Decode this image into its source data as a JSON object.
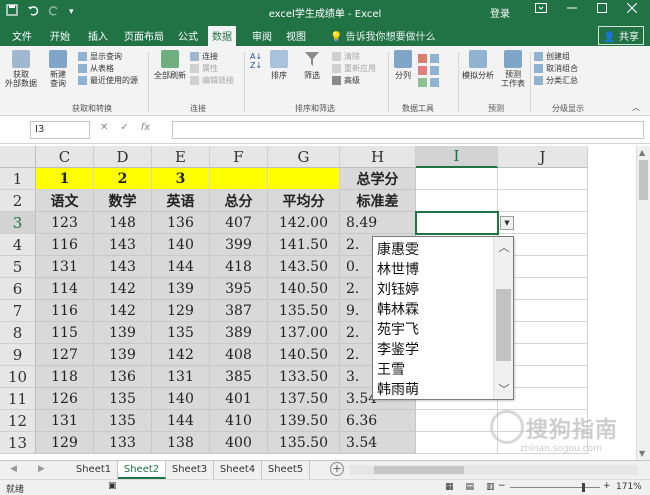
{
  "titlebar": {
    "title": "excel学生成绩单  -  Excel",
    "login": "登录",
    "accent": "#217346"
  },
  "tabs": [
    "文件",
    "开始",
    "插入",
    "页面布局",
    "公式",
    "数据",
    "审阅",
    "视图"
  ],
  "active_tab": "数据",
  "tellme": "告诉我你想要做什么",
  "share": "共享",
  "ribbon": {
    "get_external": "获取\n外部数据",
    "new_query": "新建\n查询",
    "show_queries": "显示查询",
    "from_table": "从表格",
    "recent_sources": "最近使用的源",
    "group_get_transform": "获取和转换",
    "refresh_all": "全部刷新",
    "connections": "连接",
    "properties": "属性",
    "edit_links": "编辑链接",
    "group_connections": "连接",
    "sort": "排序",
    "filter": "筛选",
    "clear": "清除",
    "reapply": "重新应用",
    "advanced": "高级",
    "group_sort_filter": "排序和筛选",
    "text_to_columns": "分列",
    "group_data_tools": "数据工具",
    "what_if": "模拟分析",
    "forecast_sheet": "预测\n工作表",
    "group_forecast": "预测",
    "group": "创建组",
    "ungroup": "取消组合",
    "subtotal": "分类汇总",
    "group_outline": "分级显示"
  },
  "namebox": "I3",
  "columns": [
    "C",
    "D",
    "E",
    "F",
    "G",
    "H",
    "I",
    "J"
  ],
  "rows": [
    {
      "num": "1",
      "cells": [
        "1",
        "2",
        "3",
        "",
        "",
        "总学分"
      ]
    },
    {
      "num": "2",
      "cells": [
        "语文",
        "数学",
        "英语",
        "总分",
        "平均分",
        "标准差"
      ]
    },
    {
      "num": "3",
      "cells": [
        "123",
        "148",
        "136",
        "407",
        "142.00",
        "8.49"
      ]
    },
    {
      "num": "4",
      "cells": [
        "116",
        "143",
        "140",
        "399",
        "141.50",
        "2."
      ]
    },
    {
      "num": "5",
      "cells": [
        "131",
        "143",
        "144",
        "418",
        "143.50",
        "0."
      ]
    },
    {
      "num": "6",
      "cells": [
        "114",
        "142",
        "139",
        "395",
        "140.50",
        "2."
      ]
    },
    {
      "num": "7",
      "cells": [
        "116",
        "142",
        "129",
        "387",
        "135.50",
        "9."
      ]
    },
    {
      "num": "8",
      "cells": [
        "115",
        "139",
        "135",
        "389",
        "137.00",
        "2."
      ]
    },
    {
      "num": "9",
      "cells": [
        "127",
        "139",
        "142",
        "408",
        "140.50",
        "2."
      ]
    },
    {
      "num": "10",
      "cells": [
        "118",
        "136",
        "131",
        "385",
        "133.50",
        "3."
      ]
    },
    {
      "num": "11",
      "cells": [
        "126",
        "135",
        "140",
        "401",
        "137.50",
        "3.54"
      ]
    },
    {
      "num": "12",
      "cells": [
        "131",
        "135",
        "144",
        "410",
        "139.50",
        "6.36"
      ]
    },
    {
      "num": "13",
      "cells": [
        "129",
        "133",
        "138",
        "400",
        "135.50",
        "3.54"
      ]
    }
  ],
  "dropdown": {
    "items": [
      "康惠雯",
      "林世博",
      "刘钰婷",
      "韩林霖",
      "苑宇飞",
      "李鉴学",
      "王雪",
      "韩雨萌"
    ]
  },
  "sheets": [
    "Sheet1",
    "Sheet2",
    "Sheet3",
    "Sheet4",
    "Sheet5"
  ],
  "active_sheet": "Sheet2",
  "status": {
    "ready": "就绪",
    "zoom": "171%"
  },
  "watermark": {
    "text": "搜狗指南",
    "url": "zhinan.sogou.com"
  }
}
